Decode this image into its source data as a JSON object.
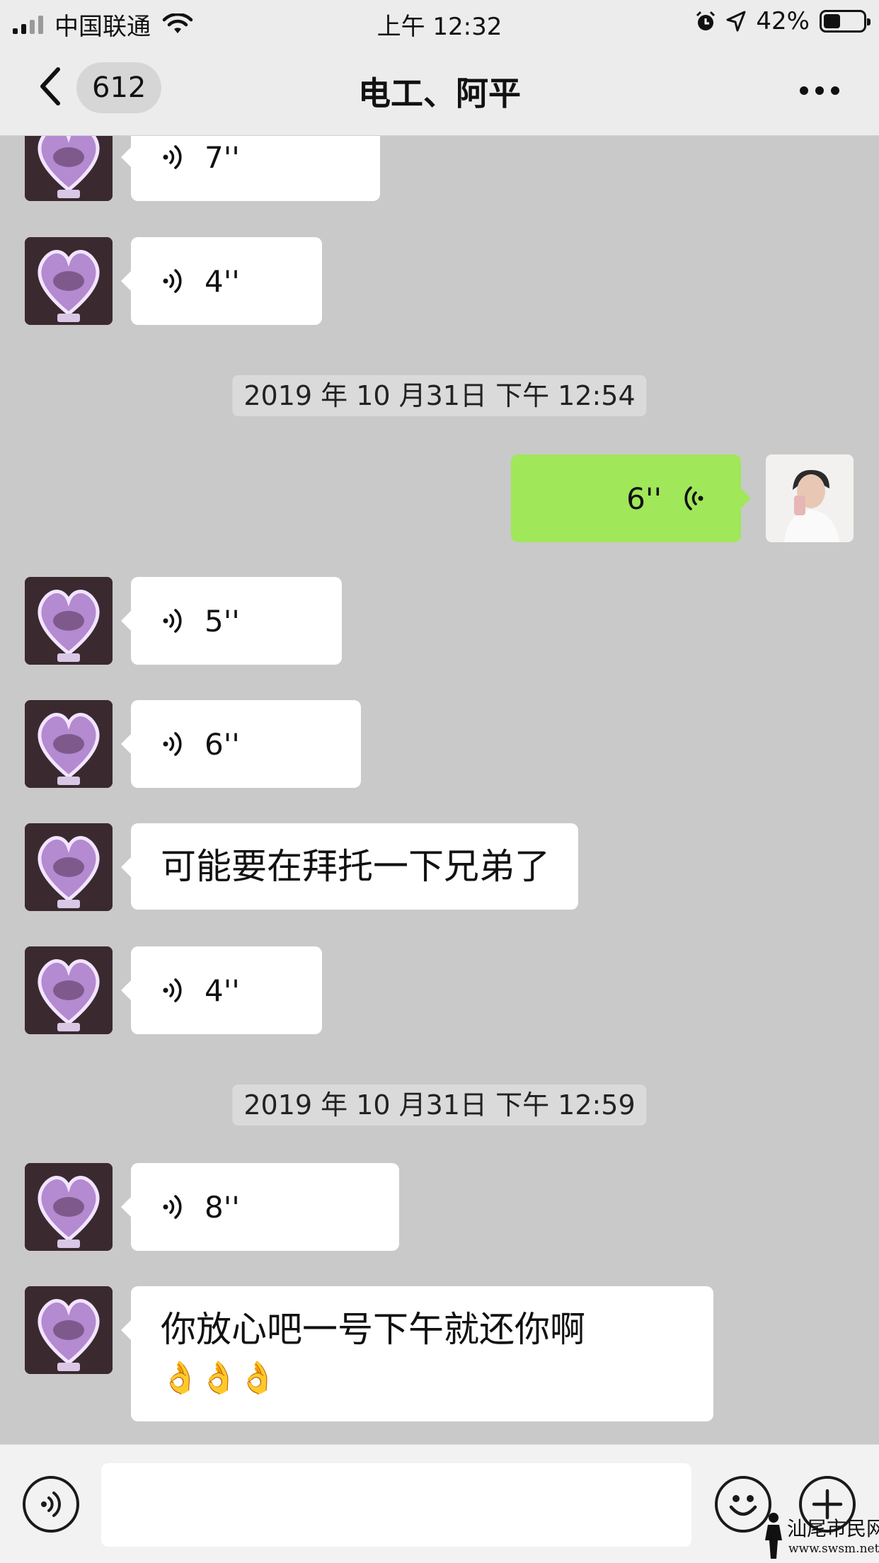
{
  "status_bar": {
    "carrier": "中国联通",
    "time": "上午 12:32",
    "battery": "42%",
    "battery_level": 0.42
  },
  "nav": {
    "unread_count": "612",
    "title": "电工、阿平"
  },
  "messages": [
    {
      "type": "voice",
      "side": "left",
      "duration": "7''"
    },
    {
      "type": "voice",
      "side": "left",
      "duration": "4''"
    },
    {
      "type": "timestamp",
      "text": "2019 年 10 月31日 下午 12:54"
    },
    {
      "type": "voice",
      "side": "right",
      "duration": "6''"
    },
    {
      "type": "voice",
      "side": "left",
      "duration": "5''"
    },
    {
      "type": "voice",
      "side": "left",
      "duration": "6''"
    },
    {
      "type": "text",
      "side": "left",
      "text": "可能要在拜托一下兄弟了"
    },
    {
      "type": "voice",
      "side": "left",
      "duration": "4''"
    },
    {
      "type": "timestamp",
      "text": "2019 年 10 月31日 下午 12:59"
    },
    {
      "type": "voice",
      "side": "left",
      "duration": "8''"
    },
    {
      "type": "text",
      "side": "left",
      "text": "你放心吧一号下午就还你啊",
      "emoji": "👌👌👌"
    }
  ],
  "input_bar": {
    "input_value": "",
    "icons": [
      "voice-toggle-icon",
      "emoji-icon",
      "plus-icon"
    ]
  },
  "watermark": {
    "text": "汕尾市民网",
    "url": "www.swsm.net"
  },
  "colors": {
    "chat_background": "#c9c9c9",
    "sent_bubble": "#a0e75a",
    "received_bubble": "#ffffff"
  }
}
